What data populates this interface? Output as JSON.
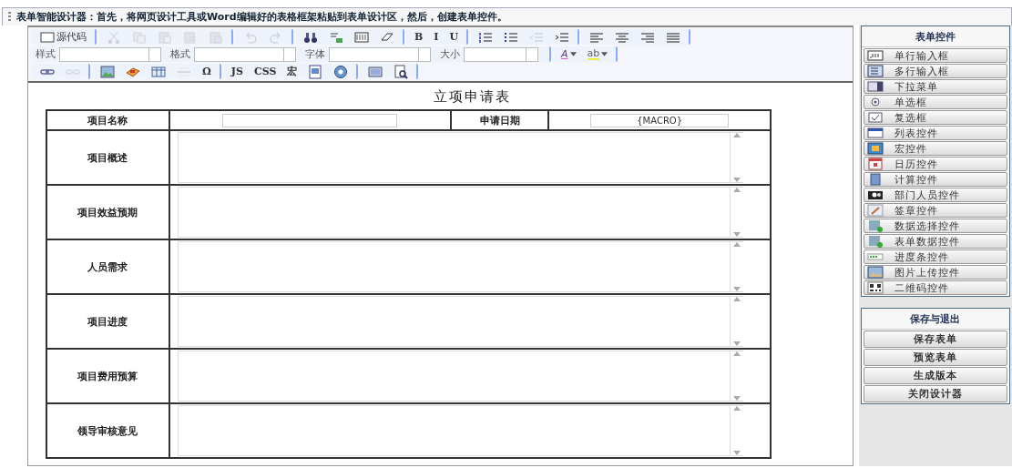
{
  "title_bar": {
    "text": "表单智能设计器：首先，将网页设计工具或Word编辑好的表格框架粘贴到表单设计区，然后，创建表单控件。"
  },
  "toolbar": {
    "rows": [
      [
        {
          "kind": "text",
          "label": "源代码",
          "disabled": false
        },
        {
          "kind": "sep"
        },
        {
          "kind": "icon",
          "disabled": true
        },
        {
          "kind": "icon",
          "disabled": true
        },
        {
          "kind": "icon",
          "disabled": true
        },
        {
          "kind": "icon",
          "disabled": true
        },
        {
          "kind": "icon",
          "disabled": true
        },
        {
          "kind": "sep"
        },
        {
          "kind": "icon",
          "disabled": true
        },
        {
          "kind": "icon",
          "disabled": true
        },
        {
          "kind": "sep"
        },
        {
          "kind": "icon",
          "disabled": false
        },
        {
          "kind": "icon",
          "disabled": false
        },
        {
          "kind": "icon",
          "disabled": false
        },
        {
          "kind": "icon",
          "disabled": false
        },
        {
          "kind": "sep"
        },
        {
          "kind": "text",
          "label": "B",
          "disabled": false
        },
        {
          "kind": "text",
          "label": "I",
          "disabled": false
        },
        {
          "kind": "text",
          "label": "U",
          "disabled": false
        },
        {
          "kind": "sep"
        },
        {
          "kind": "icon",
          "disabled": false
        },
        {
          "kind": "icon",
          "disabled": false
        },
        {
          "kind": "icon",
          "disabled": true
        },
        {
          "kind": "icon",
          "disabled": false
        },
        {
          "kind": "sep"
        },
        {
          "kind": "icon",
          "disabled": false
        },
        {
          "kind": "icon",
          "disabled": false
        },
        {
          "kind": "icon",
          "disabled": false
        },
        {
          "kind": "icon",
          "disabled": false
        }
      ],
      [
        {
          "kind": "select",
          "label": "样式"
        },
        {
          "kind": "select",
          "label": "格式"
        },
        {
          "kind": "select",
          "label": "字体"
        },
        {
          "kind": "select",
          "label": "大小"
        },
        {
          "kind": "sep"
        },
        {
          "kind": "color",
          "label": "A",
          "disabled": false
        },
        {
          "kind": "color",
          "label": "ab",
          "disabled": false
        }
      ],
      [
        {
          "kind": "icon",
          "disabled": false
        },
        {
          "kind": "icon",
          "disabled": true
        },
        {
          "kind": "sep"
        },
        {
          "kind": "icon",
          "disabled": false
        },
        {
          "kind": "icon",
          "disabled": false
        },
        {
          "kind": "icon",
          "disabled": false
        },
        {
          "kind": "icon",
          "disabled": true
        },
        {
          "kind": "text",
          "label": "Ω",
          "disabled": false
        },
        {
          "kind": "sep"
        },
        {
          "kind": "text",
          "label": "JS",
          "disabled": false
        },
        {
          "kind": "text",
          "label": "CSS",
          "disabled": false
        },
        {
          "kind": "text",
          "label": "宏",
          "disabled": false
        },
        {
          "kind": "icon",
          "disabled": false
        },
        {
          "kind": "icon",
          "disabled": false
        },
        {
          "kind": "sep"
        },
        {
          "kind": "icon",
          "disabled": false
        },
        {
          "kind": "icon",
          "disabled": false
        }
      ]
    ]
  },
  "form": {
    "title": "立项申请表",
    "header_row": [
      {
        "label": "项目名称"
      },
      {
        "label": "申请日期",
        "value": "{MACRO}"
      }
    ],
    "rows": [
      {
        "label": "项目概述"
      },
      {
        "label": "项目效益预期"
      },
      {
        "label": "人员需求"
      },
      {
        "label": "项目进度"
      },
      {
        "label": "项目费用预算"
      },
      {
        "label": "领导审核意见"
      }
    ]
  },
  "controls_panel": {
    "title": "表单控件",
    "items": [
      "单行输入框",
      "多行输入框",
      "下拉菜单",
      "单选框",
      "复选框",
      "列表控件",
      "宏控件",
      "日历控件",
      "计算控件",
      "部门人员控件",
      "签章控件",
      "数据选择控件",
      "表单数据控件",
      "进度条控件",
      "图片上传控件",
      "二维码控件"
    ]
  },
  "save_panel": {
    "title": "保存与退出",
    "buttons": [
      "保存表单",
      "预览表单",
      "生成版本",
      "关闭设计器"
    ]
  }
}
